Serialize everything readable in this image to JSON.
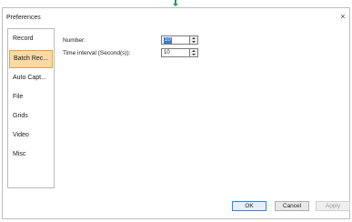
{
  "window": {
    "title": "Preferences",
    "close_glyph": "×"
  },
  "sidebar": {
    "items": [
      {
        "label": "Record",
        "active": false
      },
      {
        "label": "Batch Rec...",
        "active": true
      },
      {
        "label": "Auto Capt...",
        "active": false
      },
      {
        "label": "File",
        "active": false
      },
      {
        "label": "Grids",
        "active": false
      },
      {
        "label": "Video",
        "active": false
      },
      {
        "label": "Misc",
        "active": false
      }
    ]
  },
  "settings": {
    "number": {
      "label": "Number:",
      "value": "10"
    },
    "time_interval": {
      "label": "Time interval (Second(s)):",
      "value": "10"
    }
  },
  "footer": {
    "ok_label": "OK",
    "cancel_label": "Cancel",
    "apply_label": "Apply"
  },
  "colors": {
    "active_item_bg": "#f9d9a4",
    "active_item_border": "#e2a24a",
    "selection": "#3a78d4"
  }
}
